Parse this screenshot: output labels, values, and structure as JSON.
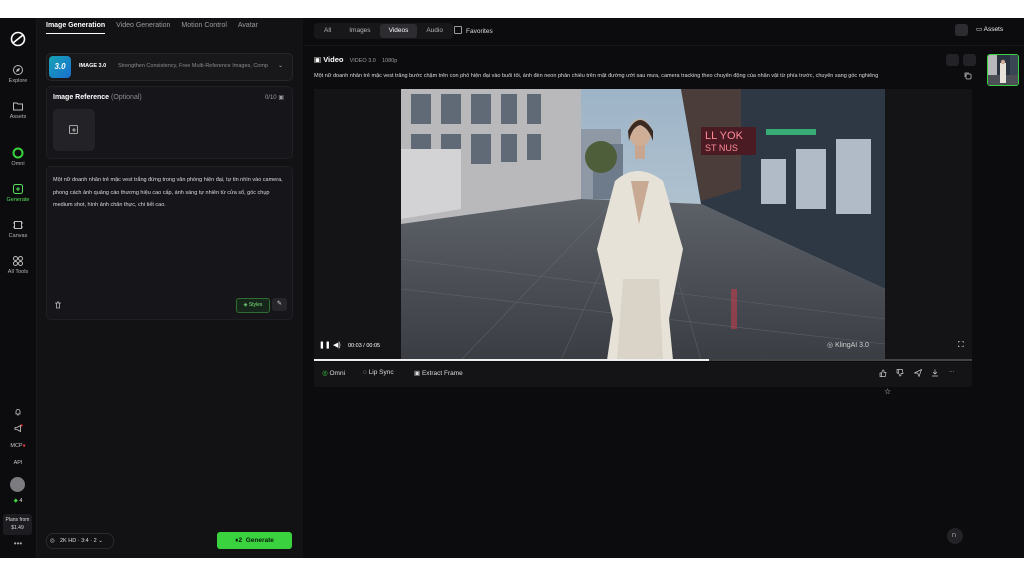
{
  "sidebar": {
    "items": [
      {
        "label": "Explore",
        "icon": "explore-icon"
      },
      {
        "label": "Assets",
        "icon": "folder-icon"
      },
      {
        "label": "Omni",
        "icon": "omni-icon"
      },
      {
        "label": "Generate",
        "icon": "generate-icon",
        "active": true
      },
      {
        "label": "Canvas",
        "icon": "canvas-icon"
      },
      {
        "label": "All Tools",
        "icon": "grid-icon"
      }
    ],
    "mcp_label": "MCP",
    "api_label": "API",
    "credits": "4",
    "plans_label": "Plans from",
    "plans_price": "$1.49"
  },
  "panel": {
    "tabs": [
      "Image Generation",
      "Video Generation",
      "Motion Control",
      "Avatar"
    ],
    "model": {
      "badge": "3.0",
      "name": "IMAGE 3.0",
      "description": "Strengthen Consistency, Free Multi-Reference Images, Comp"
    },
    "reference": {
      "title": "Image Reference",
      "optional": "(Optional)",
      "count": "0/10"
    },
    "prompt": "Một nữ doanh nhân trẻ mặc vest trắng đứng trong văn phòng hiện đại, tự tin nhìn vào camera, phong cách ảnh quảng cáo thương hiệu cao cấp, ánh sáng tự nhiên từ cửa sổ, góc chụp medium shot, hình ảnh chân thực, chi tiết cao.",
    "styles_label": "Styles",
    "settings": "2K HD · 3:4 · 2",
    "generate_cost": "2",
    "generate_label": "Generate"
  },
  "main": {
    "filters": [
      "All",
      "Images",
      "Videos",
      "Audio"
    ],
    "active_filter": "Videos",
    "favorites_label": "Favorites",
    "assets_label": "Assets",
    "video": {
      "title": "Video",
      "model": "VIDEO 3.0",
      "resolution": "1080p",
      "prompt": "Một nữ doanh nhân trẻ mặc vest trắng bước chậm trên con phố hiện đại vào buổi tối, ánh đèn neon phản chiếu trên mặt đường ướt sau mưa, camera tracking theo chuyển động của nhân vật từ phía trước, chuyển sang góc nghiêng",
      "time": "00:03 / 00:05",
      "progress": 0.6,
      "watermark": "KlingAI 3.0",
      "neon_text": "LL YOK ST NUS"
    },
    "actions": [
      "Omni",
      "Lip Sync",
      "Extract Frame"
    ]
  },
  "colors": {
    "accent": "#3ad33f",
    "background": "#0c0c0e",
    "panel": "#121214"
  }
}
